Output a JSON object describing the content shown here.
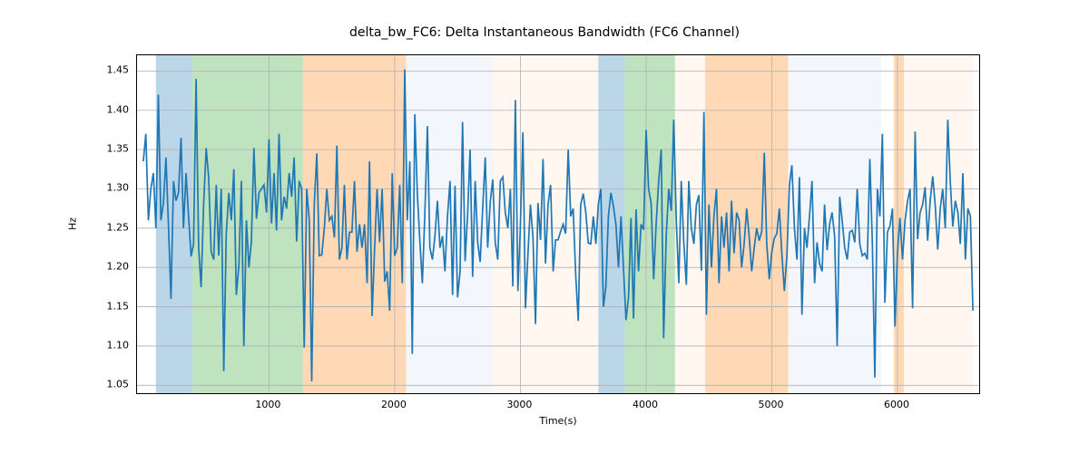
{
  "chart_data": {
    "type": "line",
    "title": "delta_bw_FC6: Delta Instantaneous Bandwidth (FC6 Channel)",
    "xlabel": "Time(s)",
    "ylabel": "Hz",
    "xlim": [
      -50,
      6650
    ],
    "ylim": [
      1.04,
      1.47
    ],
    "xticks": [
      1000,
      2000,
      3000,
      4000,
      5000,
      6000
    ],
    "yticks": [
      1.05,
      1.1,
      1.15,
      1.2,
      1.25,
      1.3,
      1.35,
      1.4,
      1.45
    ],
    "ytick_labels": [
      "1.05",
      "1.10",
      "1.15",
      "1.20",
      "1.25",
      "1.30",
      "1.35",
      "1.40",
      "1.45"
    ],
    "bands": [
      {
        "x0": 100,
        "x1": 390,
        "color": "#1f77b4"
      },
      {
        "x0": 390,
        "x1": 1270,
        "color": "#2ca02c"
      },
      {
        "x0": 1270,
        "x1": 2090,
        "color": "#ff7f0e"
      },
      {
        "x0": 2090,
        "x1": 2780,
        "color": "#d6e6f5"
      },
      {
        "x0": 2780,
        "x1": 3620,
        "color": "#ffe5cc"
      },
      {
        "x0": 3620,
        "x1": 3830,
        "color": "#1f77b4"
      },
      {
        "x0": 3830,
        "x1": 4230,
        "color": "#2ca02c"
      },
      {
        "x0": 4230,
        "x1": 4470,
        "color": "#ffe5cc"
      },
      {
        "x0": 4470,
        "x1": 5130,
        "color": "#ff7f0e"
      },
      {
        "x0": 5130,
        "x1": 5870,
        "color": "#d6e6f5"
      },
      {
        "x0": 5870,
        "x1": 5970,
        "color": "#ffffff"
      },
      {
        "x0": 5970,
        "x1": 6050,
        "color": "#ff7f0e"
      },
      {
        "x0": 6050,
        "x1": 6600,
        "color": "#ffe5cc"
      }
    ],
    "series": [
      {
        "name": "delta_bw_FC6",
        "color": "#1f77b4",
        "x_step": 20,
        "x_start": 0,
        "values": [
          1.335,
          1.37,
          1.26,
          1.3,
          1.32,
          1.25,
          1.42,
          1.26,
          1.282,
          1.34,
          1.255,
          1.16,
          1.31,
          1.285,
          1.295,
          1.365,
          1.25,
          1.32,
          1.265,
          1.214,
          1.23,
          1.44,
          1.225,
          1.175,
          1.28,
          1.352,
          1.315,
          1.22,
          1.21,
          1.305,
          1.215,
          1.3,
          1.068,
          1.242,
          1.295,
          1.26,
          1.325,
          1.165,
          1.202,
          1.31,
          1.1,
          1.26,
          1.2,
          1.233,
          1.352,
          1.262,
          1.295,
          1.3,
          1.305,
          1.27,
          1.363,
          1.256,
          1.32,
          1.247,
          1.37,
          1.26,
          1.29,
          1.275,
          1.32,
          1.29,
          1.34,
          1.233,
          1.31,
          1.3,
          1.098,
          1.3,
          1.26,
          1.055,
          1.28,
          1.345,
          1.215,
          1.216,
          1.25,
          1.3,
          1.26,
          1.265,
          1.238,
          1.355,
          1.21,
          1.225,
          1.305,
          1.21,
          1.245,
          1.245,
          1.31,
          1.22,
          1.255,
          1.225,
          1.255,
          1.18,
          1.335,
          1.138,
          1.225,
          1.3,
          1.232,
          1.3,
          1.182,
          1.195,
          1.145,
          1.32,
          1.215,
          1.225,
          1.305,
          1.18,
          1.452,
          1.26,
          1.335,
          1.09,
          1.395,
          1.293,
          1.235,
          1.18,
          1.27,
          1.38,
          1.225,
          1.21,
          1.24,
          1.285,
          1.225,
          1.24,
          1.195,
          1.265,
          1.31,
          1.165,
          1.304,
          1.162,
          1.195,
          1.385,
          1.208,
          1.268,
          1.35,
          1.188,
          1.31,
          1.232,
          1.207,
          1.275,
          1.34,
          1.225,
          1.283,
          1.312,
          1.232,
          1.21,
          1.31,
          1.315,
          1.27,
          1.25,
          1.3,
          1.176,
          1.413,
          1.17,
          1.252,
          1.372,
          1.148,
          1.218,
          1.28,
          1.238,
          1.128,
          1.282,
          1.235,
          1.338,
          1.205,
          1.28,
          1.305,
          1.195,
          1.235,
          1.235,
          1.246,
          1.255,
          1.243,
          1.35,
          1.265,
          1.275,
          1.19,
          1.132,
          1.28,
          1.294,
          1.27,
          1.231,
          1.23,
          1.265,
          1.23,
          1.28,
          1.3,
          1.15,
          1.175,
          1.265,
          1.295,
          1.278,
          1.255,
          1.2,
          1.265,
          1.2,
          1.133,
          1.162,
          1.263,
          1.135,
          1.274,
          1.195,
          1.255,
          1.248,
          1.375,
          1.3,
          1.282,
          1.185,
          1.255,
          1.31,
          1.35,
          1.11,
          1.24,
          1.3,
          1.272,
          1.388,
          1.26,
          1.18,
          1.31,
          1.232,
          1.178,
          1.31,
          1.25,
          1.23,
          1.28,
          1.292,
          1.196,
          1.398,
          1.14,
          1.28,
          1.2,
          1.265,
          1.3,
          1.18,
          1.265,
          1.225,
          1.27,
          1.195,
          1.285,
          1.218,
          1.27,
          1.26,
          1.2,
          1.23,
          1.275,
          1.24,
          1.195,
          1.225,
          1.25,
          1.234,
          1.246,
          1.346,
          1.23,
          1.185,
          1.22,
          1.237,
          1.243,
          1.275,
          1.218,
          1.17,
          1.215,
          1.305,
          1.33,
          1.25,
          1.21,
          1.315,
          1.14,
          1.25,
          1.225,
          1.265,
          1.31,
          1.18,
          1.232,
          1.205,
          1.195,
          1.28,
          1.222,
          1.255,
          1.27,
          1.24,
          1.1,
          1.29,
          1.26,
          1.225,
          1.21,
          1.245,
          1.247,
          1.232,
          1.3,
          1.23,
          1.215,
          1.218,
          1.21,
          1.338,
          1.23,
          1.06,
          1.3,
          1.265,
          1.37,
          1.155,
          1.245,
          1.253,
          1.275,
          1.125,
          1.22,
          1.263,
          1.21,
          1.26,
          1.285,
          1.3,
          1.148,
          1.373,
          1.236,
          1.27,
          1.28,
          1.302,
          1.234,
          1.285,
          1.316,
          1.28,
          1.223,
          1.275,
          1.3,
          1.25,
          1.388,
          1.31,
          1.252,
          1.285,
          1.27,
          1.23,
          1.32,
          1.21,
          1.275,
          1.265,
          1.145
        ]
      }
    ]
  }
}
